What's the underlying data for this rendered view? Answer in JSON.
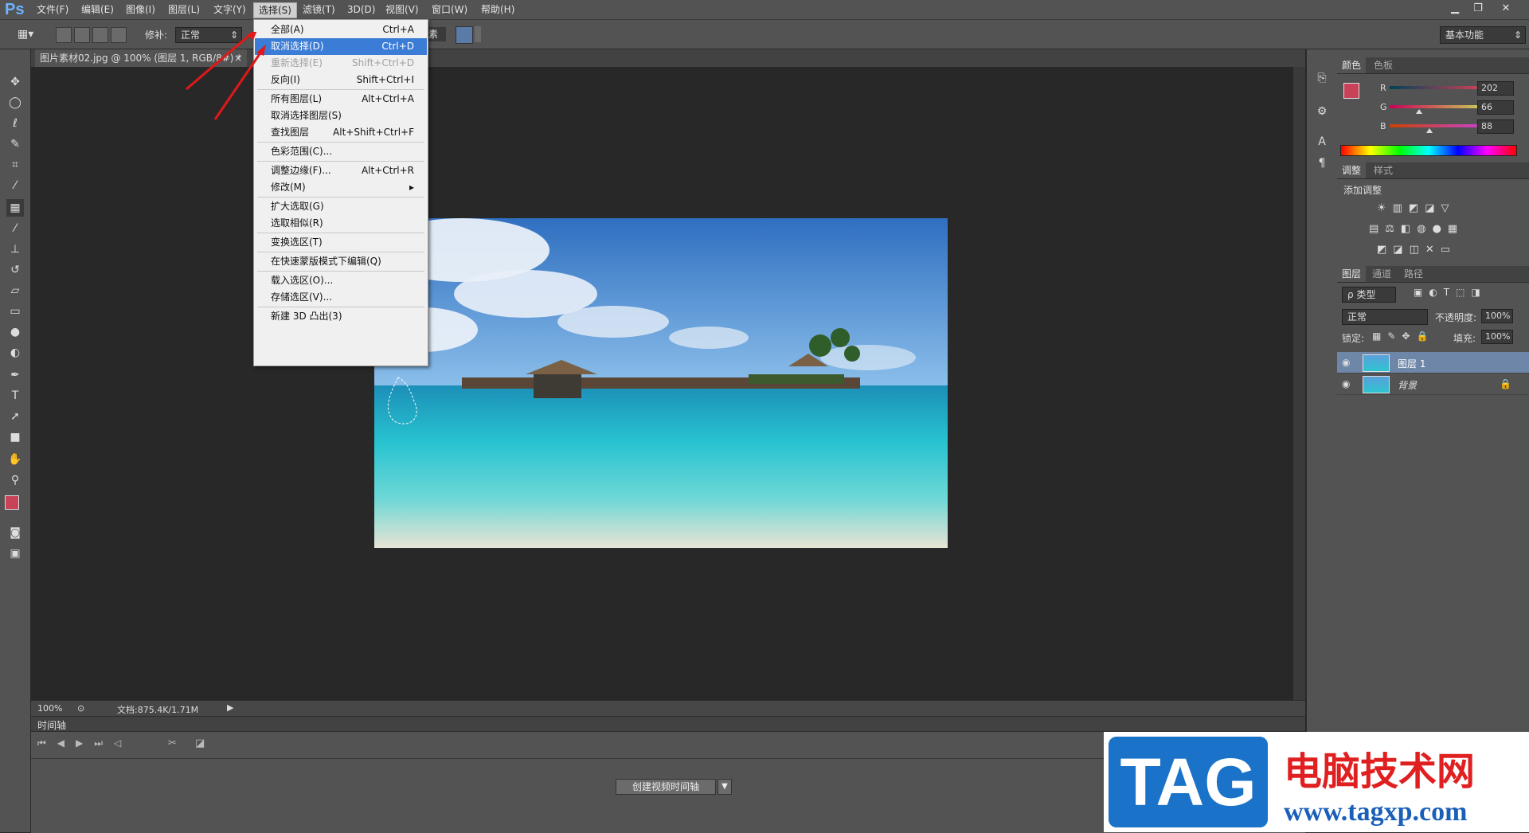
{
  "app": {
    "logo": "Ps"
  },
  "menubar": {
    "items": [
      "文件(F)",
      "编辑(E)",
      "图像(I)",
      "图层(L)",
      "文字(Y)",
      "选择(S)",
      "滤镜(T)",
      "3D(D)",
      "视图(V)",
      "窗口(W)",
      "帮助(H)"
    ],
    "open_item": "选择(S)"
  },
  "window_controls": [
    "▁",
    "❐",
    "✕"
  ],
  "options": {
    "feather_label": "修补:",
    "mode_value": "正常",
    "fragment_text": "素",
    "workspace": "基本功能"
  },
  "document": {
    "tab_title": "图片素材02.jpg @ 100% (图层 1, RGB/8#) *",
    "tab_close": "×"
  },
  "status": {
    "zoom": "100%",
    "doc_info": "文档:875.4K/1.71M"
  },
  "select_menu": {
    "items": [
      {
        "label": "全部(A)",
        "shortcut": "Ctrl+A",
        "state": "normal"
      },
      {
        "label": "取消选择(D)",
        "shortcut": "Ctrl+D",
        "state": "highlighted"
      },
      {
        "label": "重新选择(E)",
        "shortcut": "Shift+Ctrl+D",
        "state": "disabled"
      },
      {
        "label": "反向(I)",
        "shortcut": "Shift+Ctrl+I",
        "state": "normal"
      },
      {
        "label": "所有图层(L)",
        "shortcut": "Alt+Ctrl+A",
        "state": "normal"
      },
      {
        "label": "取消选择图层(S)",
        "shortcut": "",
        "state": "normal"
      },
      {
        "label": "查找图层",
        "shortcut": "Alt+Shift+Ctrl+F",
        "state": "normal"
      },
      {
        "label": "色彩范围(C)...",
        "shortcut": "",
        "state": "normal"
      },
      {
        "label": "调整边缘(F)...",
        "shortcut": "Alt+Ctrl+R",
        "state": "normal"
      },
      {
        "label": "修改(M)",
        "shortcut": "▸",
        "state": "normal"
      },
      {
        "label": "扩大选取(G)",
        "shortcut": "",
        "state": "normal"
      },
      {
        "label": "选取相似(R)",
        "shortcut": "",
        "state": "normal"
      },
      {
        "label": "变换选区(T)",
        "shortcut": "",
        "state": "normal"
      },
      {
        "label": "在快速蒙版模式下编辑(Q)",
        "shortcut": "",
        "state": "normal"
      },
      {
        "label": "载入选区(O)...",
        "shortcut": "",
        "state": "normal"
      },
      {
        "label": "存储选区(V)...",
        "shortcut": "",
        "state": "normal"
      },
      {
        "label": "新建 3D 凸出(3)",
        "shortcut": "",
        "state": "normal"
      }
    ]
  },
  "color_panel": {
    "tabs": [
      "颜色",
      "色板"
    ],
    "r_label": "R",
    "g_label": "G",
    "b_label": "B",
    "r": "202",
    "g": "66",
    "b": "88",
    "fg_color": "#ca4258",
    "r_fraction": 0.79,
    "g_fraction": 0.26,
    "b_fraction": 0.35
  },
  "adjust_panel": {
    "tabs": [
      "调整",
      "样式"
    ],
    "add_label": "添加调整"
  },
  "layers_panel": {
    "tabs": [
      "图层",
      "通道",
      "路径"
    ],
    "kind_filter": "ρ 类型",
    "blend_mode": "正常",
    "opacity_label": "不透明度:",
    "opacity": "100%",
    "lock_label": "锁定:",
    "fill_label": "填充:",
    "fill": "100%",
    "layers": [
      {
        "name": "图层 1",
        "selected": true,
        "locked": false
      },
      {
        "name": "背景",
        "selected": false,
        "locked": true
      }
    ]
  },
  "timeline": {
    "title": "时间轴",
    "create_button": "创建视频时间轴"
  },
  "watermark": {
    "logo_text": "TAG",
    "site_name": "电脑技术网",
    "url": "www.tagxp.com"
  }
}
